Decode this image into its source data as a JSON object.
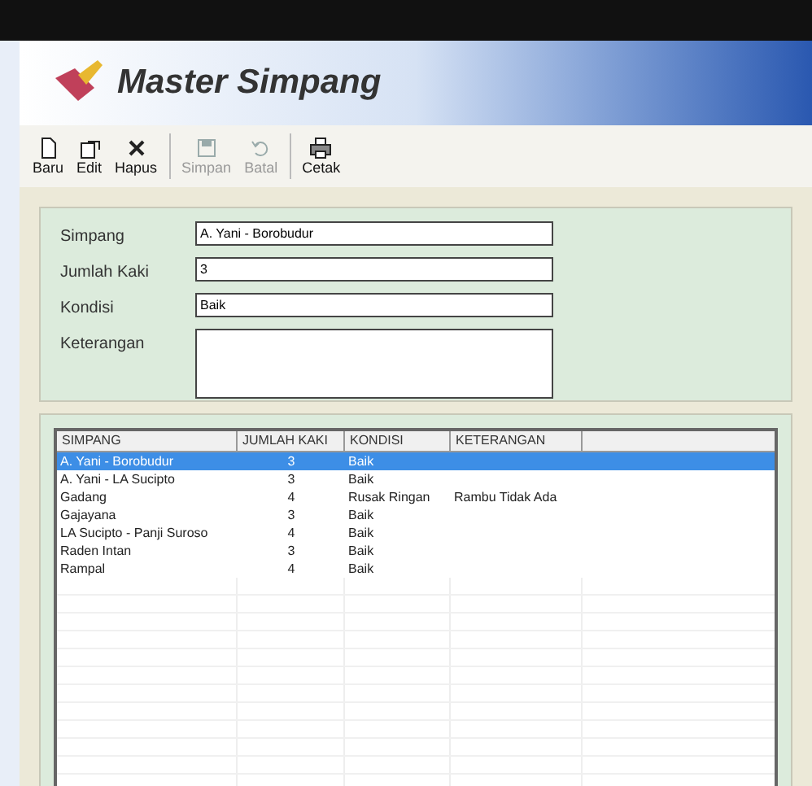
{
  "header": {
    "title": "Master Simpang"
  },
  "toolbar": [
    {
      "label": "Baru",
      "kind": "new",
      "disabled": false
    },
    {
      "label": "Edit",
      "kind": "edit",
      "disabled": false
    },
    {
      "label": "Hapus",
      "kind": "delete",
      "disabled": false
    },
    {
      "label": "Simpan",
      "kind": "save",
      "disabled": true
    },
    {
      "label": "Batal",
      "kind": "undo",
      "disabled": true
    },
    {
      "label": "Cetak",
      "kind": "print",
      "disabled": false
    }
  ],
  "form": [
    {
      "label": "Simpang",
      "value": "A. Yani - Borobudur",
      "kind": "text"
    },
    {
      "label": "Jumlah Kaki",
      "value": "3",
      "kind": "text"
    },
    {
      "label": "Kondisi",
      "value": "Baik",
      "kind": "text"
    },
    {
      "label": "Keterangan",
      "kind": "memo"
    }
  ],
  "table": {
    "columns": [
      "SIMPANG",
      "JUMLAH KAKI",
      "KONDISI",
      "KETERANGAN"
    ],
    "rows": [
      {
        "cells": [
          "A. Yani - Borobudur",
          "3",
          "Baik",
          ""
        ],
        "selected": true
      },
      {
        "cells": [
          "A. Yani - LA Sucipto",
          "3",
          "Baik",
          ""
        ],
        "selected": false
      },
      {
        "cells": [
          "Gadang",
          "4",
          "Rusak Ringan",
          "Rambu Tidak Ada"
        ],
        "selected": false
      },
      {
        "cells": [
          "Gajayana",
          "3",
          "Baik",
          ""
        ],
        "selected": false
      },
      {
        "cells": [
          "LA Sucipto - Panji Suroso",
          "4",
          "Baik",
          ""
        ],
        "selected": false
      },
      {
        "cells": [
          "Raden Intan",
          "3",
          "Baik",
          ""
        ],
        "selected": false
      },
      {
        "cells": [
          "Rampal",
          "4",
          "Baik",
          ""
        ],
        "selected": false
      }
    ]
  }
}
